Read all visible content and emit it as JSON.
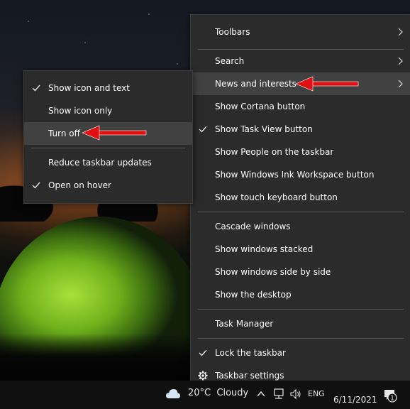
{
  "main_menu": {
    "items": [
      {
        "label": "Toolbars",
        "checked": false,
        "submenu": true
      },
      {
        "label": "Search",
        "checked": false,
        "submenu": true
      },
      {
        "label": "News and interests",
        "checked": false,
        "submenu": true,
        "highlighted": true
      },
      {
        "label": "Show Cortana button",
        "checked": false
      },
      {
        "label": "Show Task View button",
        "checked": true
      },
      {
        "label": "Show People on the taskbar",
        "checked": false
      },
      {
        "label": "Show Windows Ink Workspace button",
        "checked": false
      },
      {
        "label": "Show touch keyboard button",
        "checked": false
      },
      {
        "label": "Cascade windows",
        "checked": false
      },
      {
        "label": "Show windows stacked",
        "checked": false
      },
      {
        "label": "Show windows side by side",
        "checked": false
      },
      {
        "label": "Show the desktop",
        "checked": false
      },
      {
        "label": "Task Manager",
        "checked": false
      },
      {
        "label": "Lock the taskbar",
        "checked": true
      },
      {
        "label": "Taskbar settings",
        "icon": "gear-icon"
      }
    ]
  },
  "sub_menu": {
    "items": [
      {
        "label": "Show icon and text",
        "checked": true
      },
      {
        "label": "Show icon only",
        "checked": false
      },
      {
        "label": "Turn off",
        "checked": false,
        "highlighted": true
      },
      {
        "label": "Reduce taskbar updates",
        "checked": false
      },
      {
        "label": "Open on hover",
        "checked": true
      }
    ]
  },
  "taskbar": {
    "weather_icon": "cloud-icon",
    "weather_text": "20°C  Cloudy",
    "language": "ENG",
    "date": "6/11/2021",
    "notification_count": "1"
  },
  "colors": {
    "menu_bg": "#2b2b2b",
    "hover_bg": "#414141",
    "annotation_arrow": "#e01010"
  }
}
